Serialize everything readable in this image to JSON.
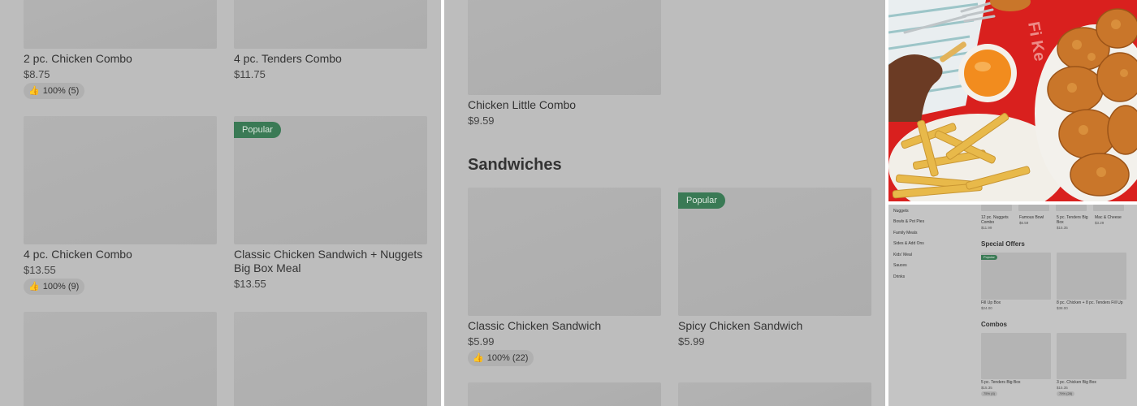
{
  "panel1": {
    "items": [
      {
        "name": "2 pc. Chicken Combo",
        "price": "$8.75",
        "rating": "100% (5)"
      },
      {
        "name": "4 pc. Tenders Combo",
        "price": "$11.75"
      },
      {
        "name": "4 pc. Chicken Combo",
        "price": "$13.55",
        "rating": "100% (9)"
      },
      {
        "name": "Classic Chicken Sandwich + Nuggets Big Box Meal",
        "price": "$13.55",
        "badge": "Popular"
      }
    ]
  },
  "panel2": {
    "top_item": {
      "name": "Chicken Little Combo",
      "price": "$9.59"
    },
    "section_title": "Sandwiches",
    "items": [
      {
        "name": "Classic Chicken Sandwich",
        "price": "$5.99",
        "rating": "100% (22)"
      },
      {
        "name": "Spicy Chicken Sandwich",
        "price": "$5.99",
        "badge": "Popular"
      }
    ]
  },
  "panel3": {
    "categories": [
      "Nuggets",
      "Bowls & Pot Pies",
      "Family Meals",
      "Sides & Add Ons",
      "Kids' Meal",
      "Sauces",
      "Drinks"
    ],
    "top_row": [
      {
        "name": "12 pc. Nuggets Combo",
        "price": "$11.99"
      },
      {
        "name": "Famous Bowl",
        "price": "$6.59"
      },
      {
        "name": "5 pc. Tenders Big Box",
        "price": "$15.35"
      },
      {
        "name": "Mac & Cheese",
        "price": "$3.29"
      }
    ],
    "special_offers_title": "Special Offers",
    "special_offers": [
      {
        "name": "Fill Up Box",
        "price": "$24.00",
        "badge": "Popular"
      },
      {
        "name": "8 pc. Chicken + 8 pc. Tenders Fill Up",
        "price": "$38.00"
      }
    ],
    "combos_title": "Combos",
    "combos": [
      {
        "name": "5 pc. Tenders Big Box",
        "price": "$15.35",
        "rating": "75% (4)"
      },
      {
        "name": "3 pc. Chicken Big Box",
        "price": "$15.35",
        "rating": "79% (28)"
      }
    ],
    "photo_text": "Fi Ke"
  },
  "icons": {
    "thumbs_up": "thumbs-up-icon"
  },
  "colors": {
    "popular_badge": "#3a7a55",
    "placeholder_bg": "#bdbdbd",
    "photo_red": "#d9201e"
  }
}
